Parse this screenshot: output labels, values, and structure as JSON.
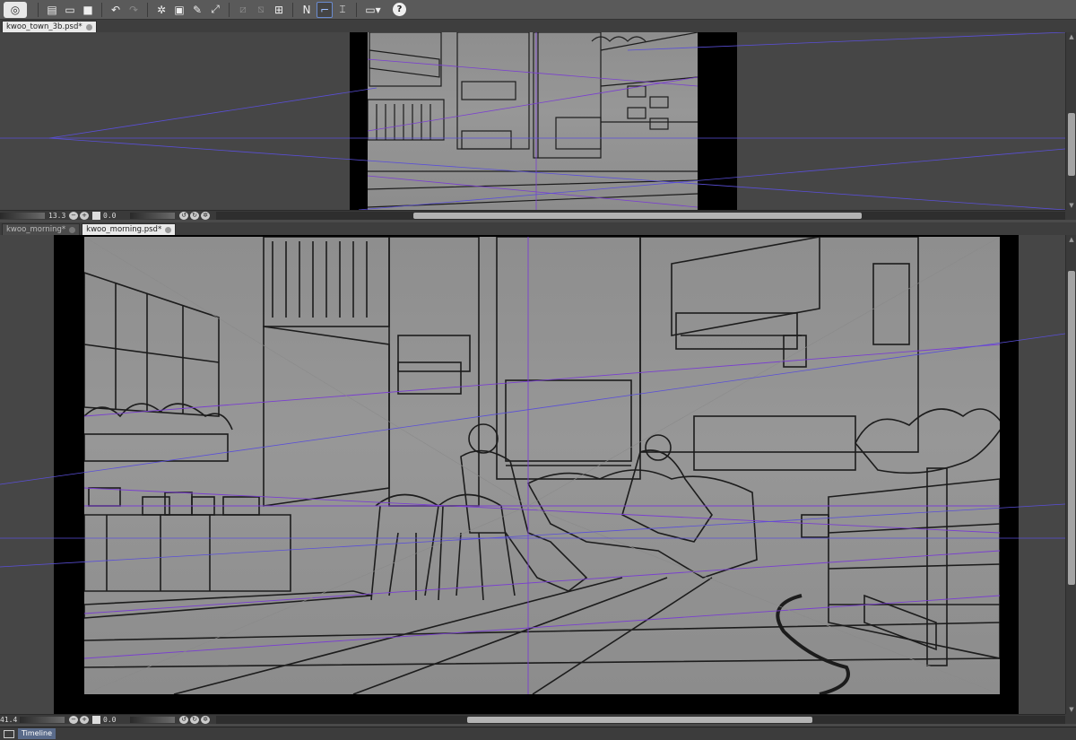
{
  "toolbar": {
    "buttons": [
      {
        "name": "app-menu-button",
        "glyph": "◎"
      },
      {
        "name": "new-file-button",
        "glyph": "▤"
      },
      {
        "name": "open-file-button",
        "glyph": "▭"
      },
      {
        "name": "save-file-button",
        "glyph": "■"
      },
      {
        "name": "undo-button",
        "glyph": "↶"
      },
      {
        "name": "redo-button",
        "glyph": "↷"
      },
      {
        "name": "clear-button",
        "glyph": "✲"
      },
      {
        "name": "fill-button",
        "glyph": "▣"
      },
      {
        "name": "select-transform-button",
        "glyph": "✎"
      },
      {
        "name": "scale-button",
        "glyph": "⤢"
      },
      {
        "name": "ruler-off-button",
        "glyph": "⧄"
      },
      {
        "name": "ruler-lock-button",
        "glyph": "⧅"
      },
      {
        "name": "grid-button",
        "glyph": "⊞"
      },
      {
        "name": "snap-ruler-button",
        "glyph": "N"
      },
      {
        "name": "snap-special-ruler-button",
        "glyph": "⌐"
      },
      {
        "name": "snap-grid-button",
        "glyph": "⌶"
      },
      {
        "name": "screen-mode-button",
        "glyph": "▭▾"
      },
      {
        "name": "help-button",
        "glyph": "?"
      }
    ]
  },
  "top_pane": {
    "tabs": [
      {
        "label": "kwoo_town_3b.psd*",
        "active": true
      }
    ],
    "zoom": "13.3",
    "angle": "0.0"
  },
  "bottom_pane": {
    "tabs": [
      {
        "label": "kwoo_morning*",
        "active": false
      },
      {
        "label": "kwoo_morning.psd*",
        "active": true
      }
    ],
    "zoom": "41.4",
    "angle": "0.0"
  },
  "bottom_bar": {
    "timeline_label": "Timeline"
  },
  "colors": {
    "perspective_guide": "#7a3fd0",
    "horizon_guide": "#5a4fd8",
    "line_art": "#1c1c1c"
  }
}
